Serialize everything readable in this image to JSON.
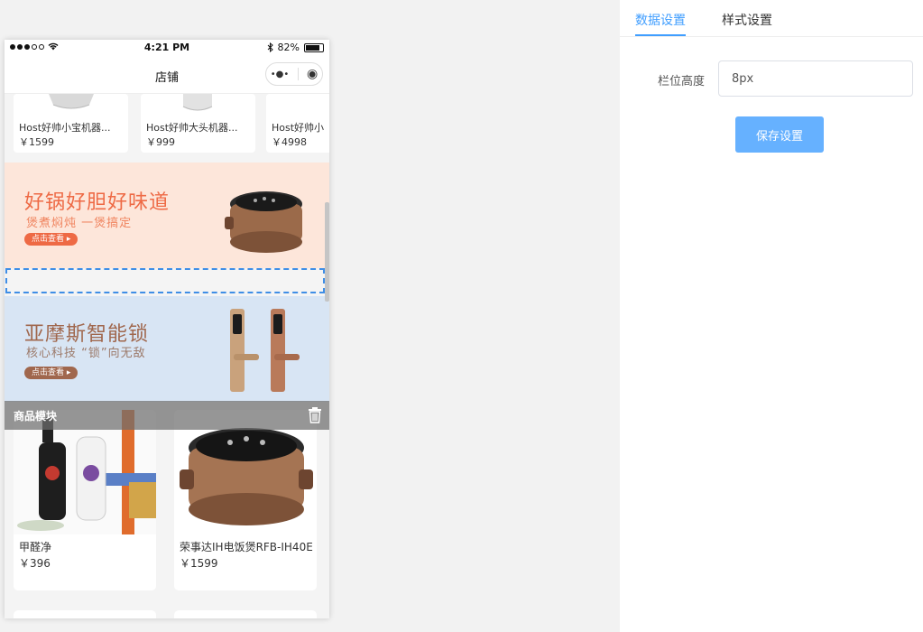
{
  "status_bar": {
    "time": "4:21 PM",
    "battery": "82%"
  },
  "navbar": {
    "title": "店铺",
    "capsule_more": "•●•",
    "capsule_close": "◉"
  },
  "product_row": [
    {
      "name": "Host好帅小宝机器...",
      "price": "￥1599"
    },
    {
      "name": "Host好帅大头机器...",
      "price": "￥999"
    },
    {
      "name": "Host好帅小",
      "price": "￥4998"
    }
  ],
  "banners": [
    {
      "title": "好锅好胆好味道",
      "subtitle": "煲煮焖炖 一煲搞定",
      "button": "点击查看 ▸"
    },
    {
      "title": "亚摩斯智能锁",
      "subtitle": "核心科技 “锁”向无敌",
      "button": "点击查看 ▸"
    }
  ],
  "module": {
    "label": "商品模块"
  },
  "goods": [
    {
      "name": "甲醛净",
      "price": "￥396"
    },
    {
      "name": "荣事达IH电饭煲RFB-IH40E",
      "price": "￥1599"
    }
  ],
  "panel": {
    "tabs": [
      {
        "label": "数据设置",
        "active": true
      },
      {
        "label": "样式设置",
        "active": false
      }
    ],
    "height_label": "栏位高度",
    "height_value": "8px",
    "save_label": "保存设置"
  },
  "colors": {
    "accent": "#409eff",
    "save_button": "#66b1ff",
    "selection": "#3f8ee6"
  }
}
